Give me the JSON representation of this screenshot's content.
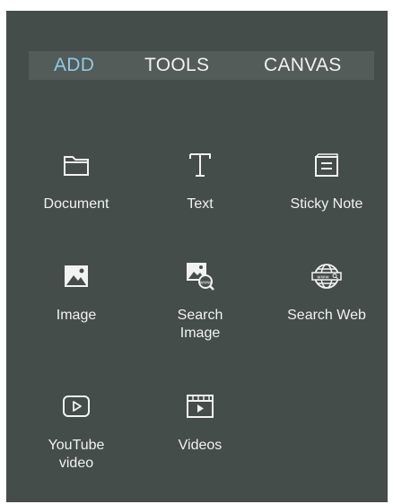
{
  "tabs": {
    "add": "ADD",
    "tools": "TOOLS",
    "canvas": "CANVAS"
  },
  "tools": {
    "document": "Document",
    "text": "Text",
    "sticky_note": "Sticky Note",
    "image": "Image",
    "search_image": [
      "Search",
      "Image"
    ],
    "search_web": "Search Web",
    "youtube_video": [
      "YouTube",
      "video"
    ],
    "videos": "Videos"
  },
  "icons": {
    "document": "folder-icon",
    "text": "text-t-icon",
    "sticky_note": "sticky-note-icon",
    "image": "image-icon",
    "search_image": "image-search-icon",
    "search_web": "globe-www-search-icon",
    "youtube_video": "play-button-icon",
    "videos": "video-clapper-icon"
  },
  "colors": {
    "panel_background": "#444d49",
    "tabbar_background": "#535c58",
    "active_tab": "#8fc9e8",
    "text": "#f2f2f2"
  }
}
